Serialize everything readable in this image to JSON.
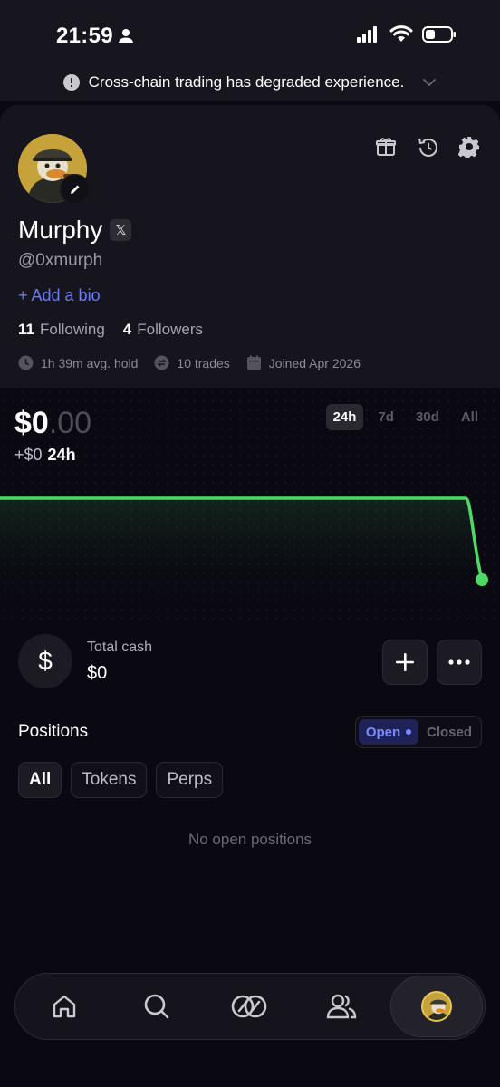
{
  "status_bar": {
    "time": "21:59"
  },
  "banner": {
    "text": "Cross-chain trading has degraded experience."
  },
  "profile": {
    "name": "Murphy",
    "x_badge": "𝕏",
    "handle": "@0xmurph",
    "add_bio": "+ Add a bio",
    "following_count": "11",
    "following_label": "Following",
    "followers_count": "4",
    "followers_label": "Followers",
    "avg_hold": "1h 39m avg. hold",
    "trades": "10 trades",
    "joined": "Joined Apr 2026"
  },
  "portfolio": {
    "value_main": "$0",
    "value_decimals": ".00",
    "change_amount": "+$0",
    "change_period": "24h",
    "ranges": [
      "24h",
      "7d",
      "30d",
      "All"
    ],
    "active_range": "24h",
    "line_color": "#4cd964"
  },
  "chart_data": {
    "type": "line",
    "title": "",
    "xlabel": "",
    "ylabel": "",
    "series": [
      {
        "values": [
          1,
          1,
          1,
          1,
          1,
          1,
          1,
          1,
          1,
          1,
          0
        ]
      }
    ]
  },
  "cash": {
    "label": "Total cash",
    "value": "$0",
    "icon": "$"
  },
  "positions": {
    "title": "Positions",
    "toggle_open": "Open",
    "toggle_closed": "Closed",
    "filters": [
      "All",
      "Tokens",
      "Perps"
    ],
    "empty_text": "No open positions"
  },
  "nav": {
    "items": [
      "home-icon",
      "search-icon",
      "trade-icon",
      "social-icon",
      "profile-avatar"
    ]
  }
}
